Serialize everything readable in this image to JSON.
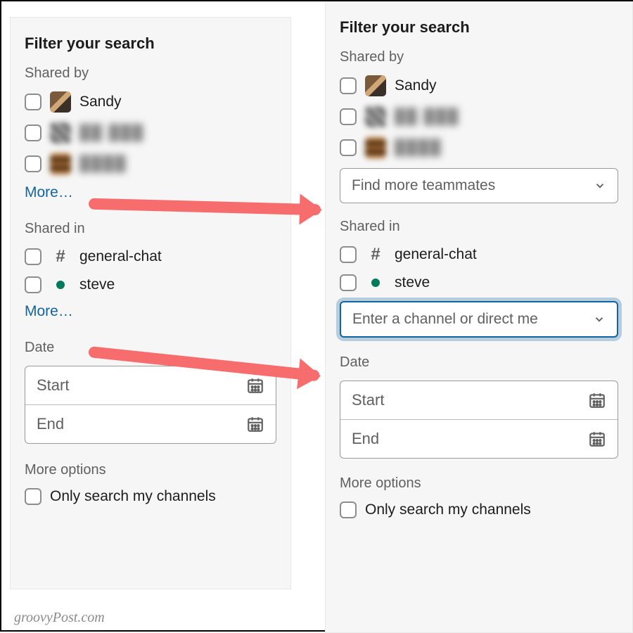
{
  "left": {
    "heading": "Filter your search",
    "shared_by_label": "Shared by",
    "people": [
      {
        "name": "Sandy",
        "avatar": "sandy"
      },
      {
        "name": "██ ███",
        "avatar": "pix2",
        "redacted": true
      },
      {
        "name": "████",
        "avatar": "pix3",
        "redacted": true
      }
    ],
    "more_people": "More…",
    "shared_in_label": "Shared in",
    "channels": [
      {
        "kind": "channel",
        "name": "general-chat"
      },
      {
        "kind": "dm",
        "name": "steve"
      }
    ],
    "more_channels": "More…",
    "date_label": "Date",
    "date_start": "Start",
    "date_end": "End",
    "more_options_label": "More options",
    "only_my_channels": "Only search my channels"
  },
  "right": {
    "heading": "Filter your search",
    "shared_by_label": "Shared by",
    "people": [
      {
        "name": "Sandy",
        "avatar": "sandy"
      },
      {
        "name": "██ ███",
        "avatar": "pix2",
        "redacted": true
      },
      {
        "name": "████",
        "avatar": "pix3",
        "redacted": true
      }
    ],
    "find_more_placeholder": "Find more teammates",
    "shared_in_label": "Shared in",
    "channels": [
      {
        "kind": "channel",
        "name": "general-chat"
      },
      {
        "kind": "dm",
        "name": "steve"
      }
    ],
    "enter_channel_placeholder": "Enter a channel or direct me",
    "date_label": "Date",
    "date_start": "Start",
    "date_end": "End",
    "more_options_label": "More options",
    "only_my_channels": "Only search my channels"
  },
  "watermark": "groovyPost.com",
  "icons": {
    "chevron_down": "chevron-down-icon",
    "calendar": "calendar-icon",
    "hash": "hash-icon",
    "presence": "presence-dot-icon"
  },
  "colors": {
    "link": "#1264a3",
    "arrow": "#f76c6c",
    "presence": "#007a5a"
  }
}
